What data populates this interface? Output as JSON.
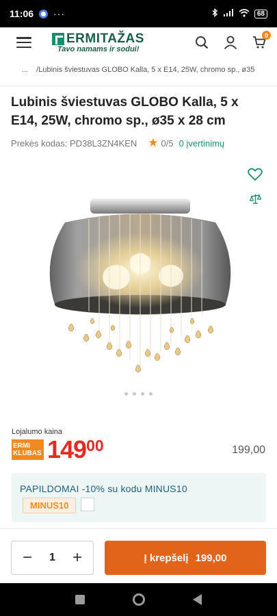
{
  "status_bar": {
    "time": "11:06",
    "more": "···",
    "battery": "68"
  },
  "header": {
    "logo_name": "ERMITAŽAS",
    "logo_tagline": "Tavo namams ir sodui!",
    "cart_count": "0"
  },
  "breadcrumb": {
    "ellipsis": "...",
    "current": "/Lubinis šviestuvas GLOBO Kalla, 5 x E14, 25W, chromo sp., ø35"
  },
  "product": {
    "title": "Lubinis šviestuvas GLOBO Kalla, 5 x E14, 25W, chromo sp., ø35 x 28 cm",
    "code_label": "Prekės kodas: PD38L3ZN4KEN",
    "rating": "0/5",
    "reviews": "0 įvertinimų",
    "image_icon": "ceiling-lamp-image",
    "gallery_pages": 4
  },
  "pricing": {
    "loyalty_label": "Lojalumo kaina",
    "badge_line1": "ERMI",
    "badge_line2": "KLUBAS",
    "price_main": "149",
    "price_cents": "00",
    "regular_price": "199,00",
    "accent_color": "#e22c24"
  },
  "promo": {
    "text": "PAPILDOMAI -10% su kodu MINUS10",
    "code": "MINUS10"
  },
  "purchase": {
    "minus": "−",
    "quantity": "1",
    "plus": "+",
    "cart_label": "Į krepšelį",
    "cart_price": "199,00",
    "button_color": "#e2631a"
  }
}
